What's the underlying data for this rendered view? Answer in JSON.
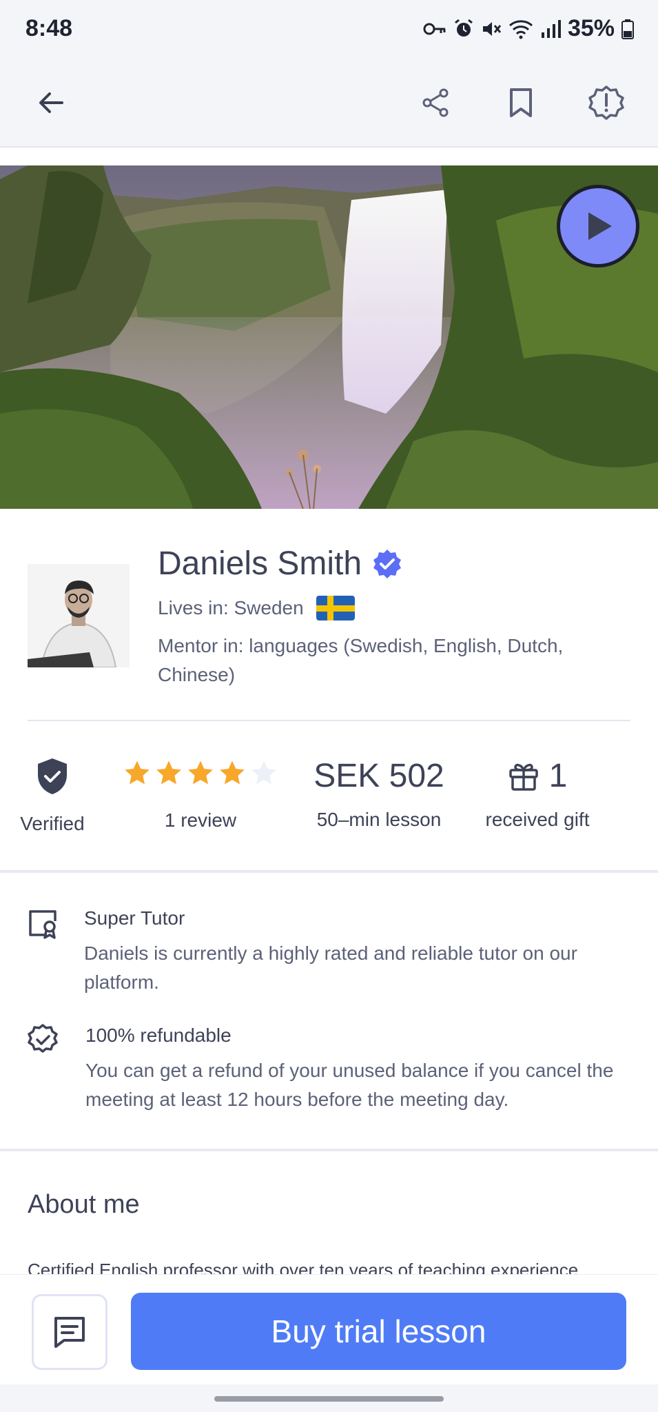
{
  "status_bar": {
    "time": "8:48",
    "battery": "35%",
    "icons": [
      "vpn-key-icon",
      "alarm-icon",
      "mute-icon",
      "wifi-icon",
      "signal-icon",
      "battery-icon"
    ]
  },
  "top_bar": {
    "icons": [
      "back-arrow-icon",
      "share-icon",
      "bookmark-icon",
      "report-icon"
    ]
  },
  "hero": {
    "play_icon": "play-icon",
    "accent": "#7e8af7"
  },
  "profile": {
    "name": "Daniels Smith",
    "verified_icon": "verified-badge-icon",
    "lives_in": "Lives in: Sweden",
    "flag_icon": "sweden-flag-icon",
    "mentor_in": "Mentor in: languages (Swedish, English, Dutch, Chinese)"
  },
  "stats": {
    "verified_label": "Verified",
    "rating": 4,
    "rating_max": 5,
    "reviews_label": "1 review",
    "price": "SEK 502",
    "price_label": "50–min lesson",
    "gifts_count": "1",
    "gifts_label": "received gift",
    "star_color": "#f7a72a"
  },
  "features": [
    {
      "icon": "certificate-icon",
      "title": "Super Tutor",
      "description": "Daniels is currently a highly rated and reliable tutor on our platform."
    },
    {
      "icon": "check-badge-icon",
      "title": "100% refundable",
      "description": "You can get a refund of your unused balance if you cancel the meeting at least 12 hours before the meeting day."
    }
  ],
  "about": {
    "title": "About me",
    "text": "Certified English professor with over ten years of teaching experience."
  },
  "bottom": {
    "chat_icon": "chat-icon",
    "buy_label": "Buy trial lesson",
    "accent": "#4f7cf6"
  }
}
